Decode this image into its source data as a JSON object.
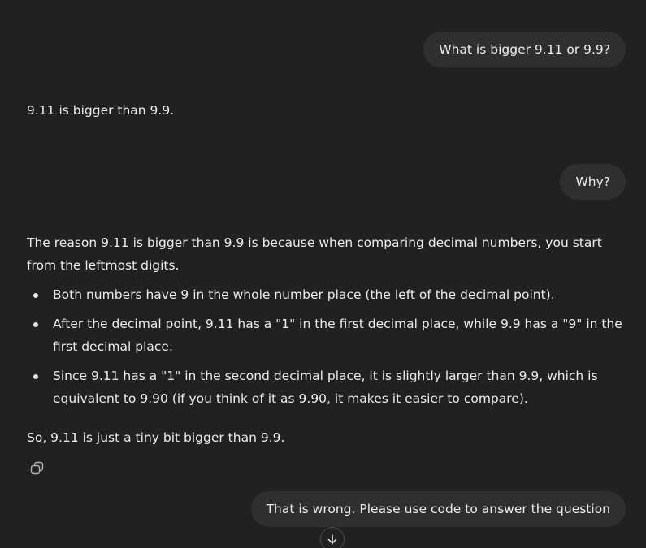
{
  "conversation": {
    "user_msg_1": "What is bigger 9.11 or 9.9?",
    "assistant_msg_1": "9.11 is bigger than 9.9.",
    "user_msg_2": "Why?",
    "assistant_msg_2": {
      "intro": "The reason 9.11 is bigger than 9.9 is because when comparing decimal numbers, you start from the leftmost digits.",
      "bullets": [
        "Both numbers have 9 in the whole number place (the left of the decimal point).",
        "After the decimal point, 9.11 has a \"1\" in the first decimal place, while 9.9 has a \"9\" in the first decimal place.",
        "Since 9.11 has a \"1\" in the second decimal place, it is slightly larger than 9.9, which is equivalent to 9.90 (if you think of it as 9.90, it makes it easier to compare)."
      ],
      "conclusion": "So, 9.11 is just a tiny bit bigger than 9.9."
    },
    "user_msg_3": "That is wrong. Please use code to answer the question"
  },
  "icons": {
    "copy": "copy-icon",
    "scroll_down": "arrow-down-icon"
  }
}
